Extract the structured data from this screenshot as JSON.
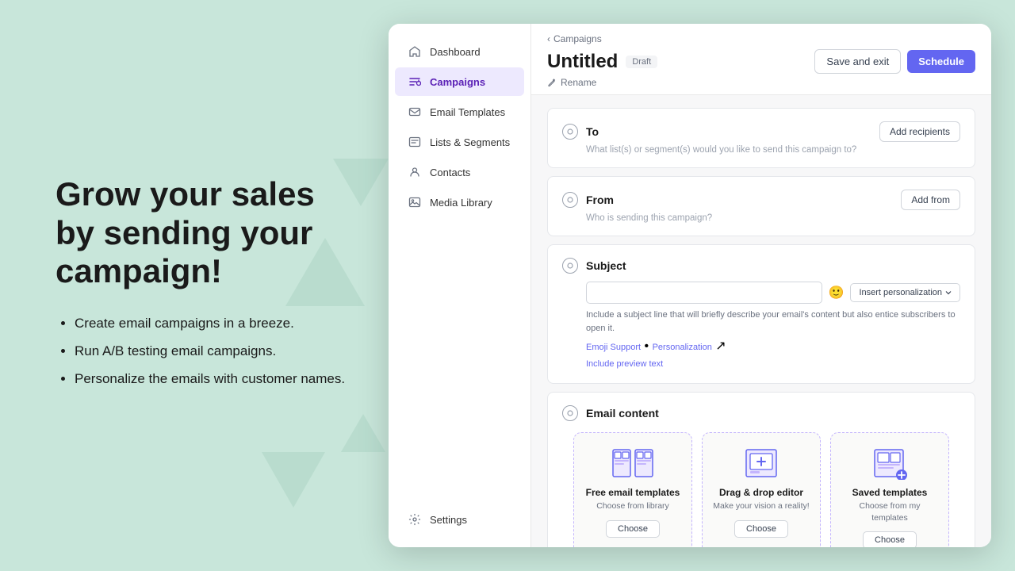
{
  "hero": {
    "title": "Grow your sales by sending your campaign!",
    "bullets": [
      "Create email campaigns in a breeze.",
      "Run A/B testing email campaigns.",
      "Personalize the emails with customer names."
    ]
  },
  "sidebar": {
    "items": [
      {
        "id": "dashboard",
        "label": "Dashboard",
        "icon": "home-icon",
        "active": false
      },
      {
        "id": "campaigns",
        "label": "Campaigns",
        "icon": "campaigns-icon",
        "active": true
      },
      {
        "id": "email-templates",
        "label": "Email Templates",
        "icon": "email-icon",
        "active": false
      },
      {
        "id": "lists-segments",
        "label": "Lists & Segments",
        "icon": "list-icon",
        "active": false
      },
      {
        "id": "contacts",
        "label": "Contacts",
        "icon": "contacts-icon",
        "active": false
      },
      {
        "id": "media-library",
        "label": "Media Library",
        "icon": "media-icon",
        "active": false
      }
    ],
    "settings_label": "Settings"
  },
  "topbar": {
    "breadcrumb_back": "Campaigns",
    "title": "Untitled",
    "draft_badge": "Draft",
    "rename_label": "Rename",
    "save_exit_label": "Save and exit",
    "schedule_label": "Schedule"
  },
  "sections": {
    "to": {
      "title": "To",
      "hint": "What list(s) or segment(s) would you like to send this campaign to?",
      "btn_label": "Add recipients"
    },
    "from": {
      "title": "From",
      "hint": "Who is sending this campaign?",
      "btn_label": "Add from"
    },
    "subject": {
      "title": "Subject",
      "input_placeholder": "",
      "personalize_label": "Insert personalization",
      "desc": "Include a subject line that will briefly describe your email's content but also entice subscribers to open it.",
      "emoji_link": "Emoji Support",
      "personalization_link": "Personalization",
      "preview_link": "Include preview text"
    },
    "email_content": {
      "title": "Email content",
      "options": [
        {
          "id": "free-templates",
          "title": "Free email templates",
          "desc": "Choose from library",
          "btn_label": "Choose"
        },
        {
          "id": "drag-drop",
          "title": "Drag & drop editor",
          "desc": "Make your vision a reality!",
          "btn_label": "Choose"
        },
        {
          "id": "saved-templates",
          "title": "Saved templates",
          "desc": "Choose from my templates",
          "btn_label": "Choose"
        }
      ]
    }
  },
  "colors": {
    "accent": "#6366f1",
    "active_bg": "#ede9fe",
    "active_text": "#5b21b6",
    "border_dashed": "#c4b5fd"
  }
}
